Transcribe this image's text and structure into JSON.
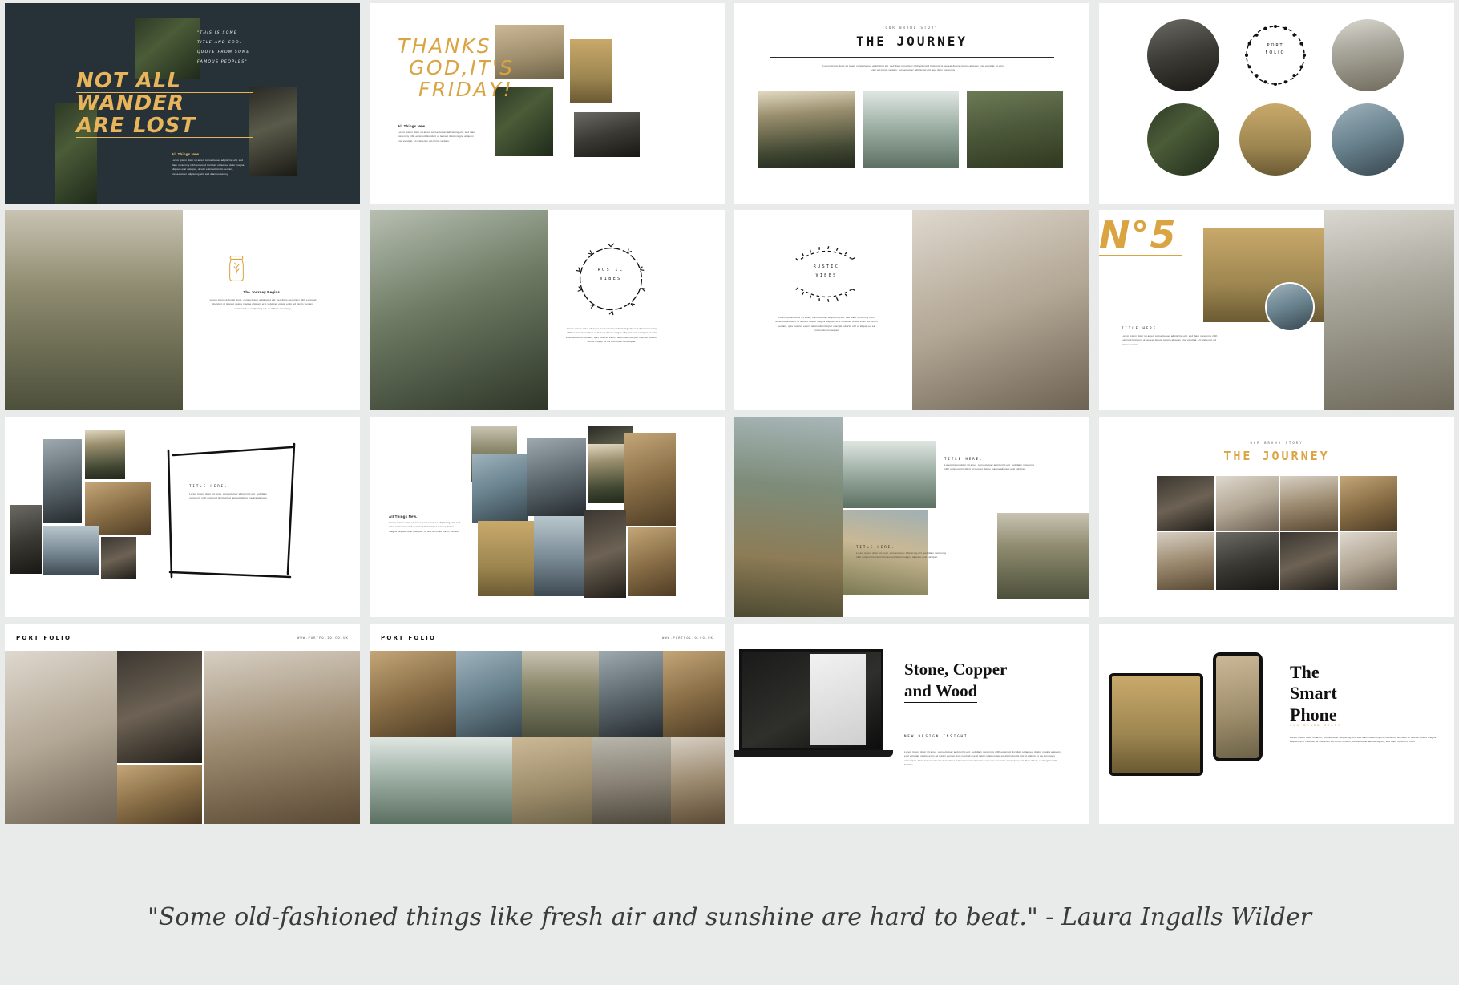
{
  "page": {
    "background_color": "#e9eaea",
    "quote": "\"Some old-fashioned things like fresh air and sunshine are hard to beat.\" - Laura Ingalls Wilder"
  },
  "palette": {
    "dark_navy": "#263238",
    "gold": "#d9a441",
    "white": "#ffffff",
    "body_text": "#4a4a4a"
  },
  "body_text": {
    "lorem_long": "Lorem ipsum dolor sit amet, consectetuer adipiscing elit, sed diam nonummy nibh euismod tincidunt ut laoreet dolore magna aliquam erat volutpat, ut wisi enim ad minim veniam, consectetuer adipiscing elit, sed diam nonummy.",
    "lorem_medium": "Lorem ipsum dolor sit amet, consectetuer adipiscing elit, sed diam nonummy nibh euismod tincidunt ut laoreet dolore magna aliquam erat volutpat. Ut wisi enim ad minim veniam.",
    "lorem_short": "Lorem ipsum dolor sit amet, consectetuer adipiscing elit, sed diam nonummy nibh euismod tincidunt ut laoreet dolore magna aliquam erat volutpat.",
    "lorem_tiny": "Lorem ipsum dolor sit amet, consectetuer adipiscing elit, sed diam nonummy nibh euismod."
  },
  "slides": [
    {
      "index": 1,
      "name": "not-all-wander-are-lost",
      "theme": "dark",
      "headline_lines": [
        "NOT ALL",
        "WANDER",
        "ARE LOST"
      ],
      "handwritten_lines": [
        "\"THIS IS SOME",
        "TITLE AND COOL",
        "QUOTE FROM SOME",
        "FAMOUS PEOPLES\""
      ],
      "body_title": "All Things New.",
      "body_text": "Lorem ipsum dolor sit amet, consectetuer adipiscing elit, sed diam nonummy nibh euismod tincidunt ut laoreet dolor magna aliquam erat volutpat, ut wisi enim ad minim veniam, consectetuer adipiscing elit, sed diam nonummy."
    },
    {
      "index": 2,
      "name": "thanks-god-its-friday",
      "theme": "light",
      "headline_lines": [
        "THANKS",
        "GOD,IT'S",
        "FRIDAY!"
      ],
      "body_title": "All Things New.",
      "body_text": "Lorem ipsum dolor sit amet, consectetuer adipiscing elit, sed diam nonummy nibh euismod tincidunt ut laoreet dolor magna aliquam erat volutpat. Ut wisi enim ad minim veniam."
    },
    {
      "index": 3,
      "name": "the-journey",
      "theme": "light",
      "eyebrow": "OUR BRAND STORY",
      "title": "THE JOURNEY",
      "body_text": "Lorem ipsum dolor sit amet, consectetuer adipiscing elit, sed diam nonummy nibh euismod tincidunt ut laoreet dolore magna aliquam erat volutpat, ut wisi enim ad minim veniam, consectetuer adipiscing elit, sed diam nonummy."
    },
    {
      "index": 4,
      "name": "portfolio-circles",
      "theme": "light",
      "wreath_label_lines": [
        "PORT",
        "FOLIO"
      ]
    },
    {
      "index": 5,
      "name": "the-journey-begins",
      "theme": "light",
      "icon": "mason-jar-icon",
      "title": "The Journey Begins.",
      "body_text": "Lorem ipsum dolor sit amet, consectetuer adipiscing elit, sed diam nonummy nibh euismod tincidunt ut laoreet dolore magna aliquam erat volutpat, ut wisi enim ad minim veniam, consectetuer adipiscing elit, sed diam nonummy."
    },
    {
      "index": 6,
      "name": "rustic-vibes-leaf-wreath",
      "theme": "light",
      "wreath_label_lines": [
        "RUSTIC",
        "VIBES"
      ],
      "body_text": "Lorem ipsum dolor sit amet, consectetuer adipiscing elit, sed diam nonummy nibh euismod tincidunt ut laoreet dolore magna aliquam erat volutpat, ut wisi enim ad minim veniam, quis nostrud exerci tation ullamcorper suscipit lobortis nisl ut aliquip ex ea commodo consequat."
    },
    {
      "index": 7,
      "name": "rustic-vibes-arc-wreath",
      "theme": "light",
      "wreath_label_lines": [
        "RUSTIC",
        "VIBES"
      ],
      "body_text": "Lorem ipsum dolor sit amet, consectetuer adipiscing elit, sed diam nonummy nibh euismod tincidunt ut laoreet dolore magna aliquam erat volutpat, ut wisi enim ad minim veniam, quis nostrud exerci tation ullamcorper suscipit lobortis nisl ut aliquip ex ea commodo consequat."
    },
    {
      "index": 8,
      "name": "number-five",
      "theme": "light",
      "number_label": "N°5",
      "caption": "TITLE HERE.",
      "body_text": "Lorem ipsum dolor sit amet, consectetuer adipiscing elit, sed diam nonummy nibh euismod tincidunt ut laoreet dolore magna aliquam erat volutpat. Ut wisi enim ad minim veniam."
    },
    {
      "index": 9,
      "name": "sketch-frame-collage",
      "theme": "light",
      "caption": "TITLE HERE.",
      "body_text": "Lorem ipsum dolor sit amet, consectetuer adipiscing elit, sed diam nonummy nibh euismod tincidunt ut laoreet dolore magna aliquam."
    },
    {
      "index": 10,
      "name": "all-things-new-grid",
      "theme": "light",
      "body_title": "All Things New.",
      "body_text": "Lorem ipsum dolor sit amet, consectetuer adipiscing elit, sed diam nonummy nibh euismod tincidunt ut laoreet dolore magna aliquam erat volutpat. Ut wisi enim ad minim veniam."
    },
    {
      "index": 11,
      "name": "coastline-collage",
      "theme": "light",
      "caption_top": "TITLE HERE.",
      "caption_bottom": "TITLE HERE.",
      "body_text_top": "Lorem ipsum dolor sit amet, consectetuer adipiscing elit, sed diam nonummy nibh euismod tincidunt ut laoreet dolore magna aliquam erat volutpat.",
      "body_text_bottom": "Lorem ipsum dolor sit amet, consectetuer adipiscing elit, sed diam nonummy nibh euismod tincidunt ut laoreet dolore magna aliquam erat volutpat."
    },
    {
      "index": 12,
      "name": "the-journey-gold-grid",
      "theme": "light",
      "eyebrow": "OUR BRAND STORY",
      "title": "THE JOURNEY"
    },
    {
      "index": 13,
      "name": "portfolio-interior",
      "theme": "light",
      "logo": "PORT FOLIO",
      "website": "WWW.PORTFOLIO.CO.UK"
    },
    {
      "index": 14,
      "name": "portfolio-outdoor-grid",
      "theme": "light",
      "logo": "PORT FOLIO",
      "website": "WWW.PORTFOLIO.CO.UK"
    },
    {
      "index": 15,
      "name": "stone-copper-and-wood",
      "theme": "light",
      "headline_lines": [
        "Stone,",
        "Copper",
        "and Wood"
      ],
      "eyebrow": "NEW DESIGN INSIGHT",
      "body_text": "Lorem ipsum dolor sit amet, consectetuer adipiscing elit, sed diam nonummy nibh euismod tincidunt ut laoreet dolore magna aliquam erat volutpat, ut wisi enim ad minim veniam quis nostrud exerci tation ullamcorper suscipit lobortis nisl ut aliquip ex ea commodo consequat. Duis autem vel eum iriure dolor in hendrerit in vulputate velit esse molestie consequat, vel illum dolore eu feugiat nulla facilisis."
    },
    {
      "index": 16,
      "name": "the-smart-phone",
      "theme": "light",
      "headline_lines": [
        "The",
        "Smart",
        "Phone"
      ],
      "eyebrow": "OUR BRAND STORY",
      "body_text": "Lorem ipsum dolor sit amet, consectetuer adipiscing elit, sed diam nonummy nibh euismod tincidunt ut laoreet dolore magna aliquam erat volutpat, ut wisi enim ad minim veniam, consectetuer adipiscing elit, sed diam nonummy nibh."
    }
  ]
}
